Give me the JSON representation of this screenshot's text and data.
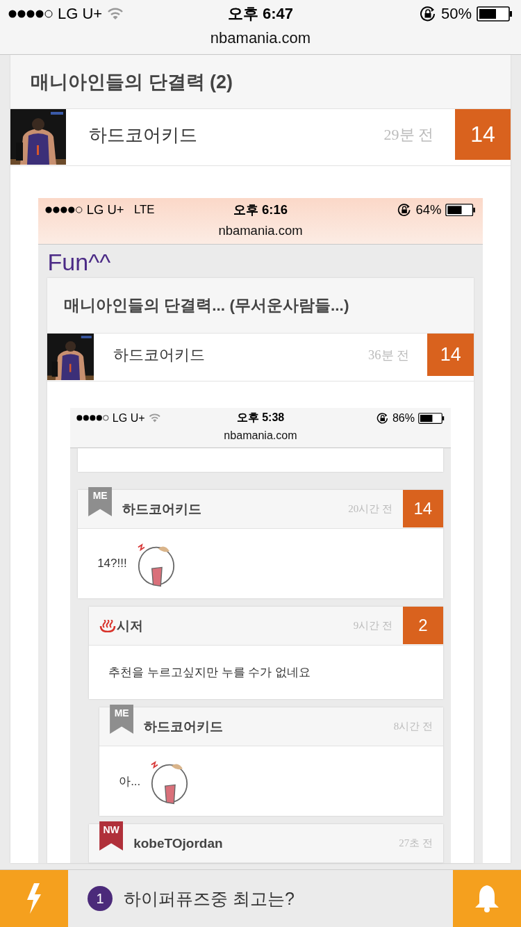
{
  "screen": {
    "status_bar": {
      "carrier": "LG U+",
      "time": "오후 6:47",
      "battery": "50%",
      "url": "nbamania.com"
    },
    "post": {
      "title": "매니아인들의 단결력 (2)",
      "author": "하드코어키드",
      "time": "29분 전",
      "count": "14"
    },
    "embedded_screen": {
      "status_bar": {
        "carrier": "LG U+",
        "network": "LTE",
        "time": "오후 6:16",
        "battery": "64%",
        "url": "nbamania.com"
      },
      "section_title": "Fun^^",
      "post": {
        "title": "매니아인들의 단결력... (무서운사람들...)",
        "author": "하드코어키드",
        "time": "36분 전",
        "count": "14"
      },
      "embedded_screen": {
        "status_bar": {
          "carrier": "LG U+",
          "time": "오후 5:38",
          "battery": "86%",
          "url": "nbamania.com"
        },
        "comments": [
          {
            "badge": {
              "kind": "me",
              "label": "ME"
            },
            "author": "하드코어키드",
            "time": "20시간 전",
            "count": "14",
            "body": "14?!!!",
            "sticker": true,
            "children": [
              {
                "badge": {
                  "kind": "hot"
                },
                "author": "시저",
                "time": "9시간 전",
                "count": "2",
                "body": "추천을 누르고싶지만 누를 수가 없네요",
                "sticker": false,
                "children": [
                  {
                    "badge": {
                      "kind": "me",
                      "label": "ME"
                    },
                    "author": "하드코어키드",
                    "time": "8시간 전",
                    "body": "아...",
                    "sticker": true
                  }
                ]
              },
              {
                "badge": {
                  "kind": "nw",
                  "label": "NW"
                },
                "author": "kobeTOjordan",
                "time": "27초 전"
              }
            ]
          }
        ]
      }
    }
  },
  "bottom_bar": {
    "notice_number": "1",
    "notice": "하이퍼퓨즈중 최고는?"
  }
}
